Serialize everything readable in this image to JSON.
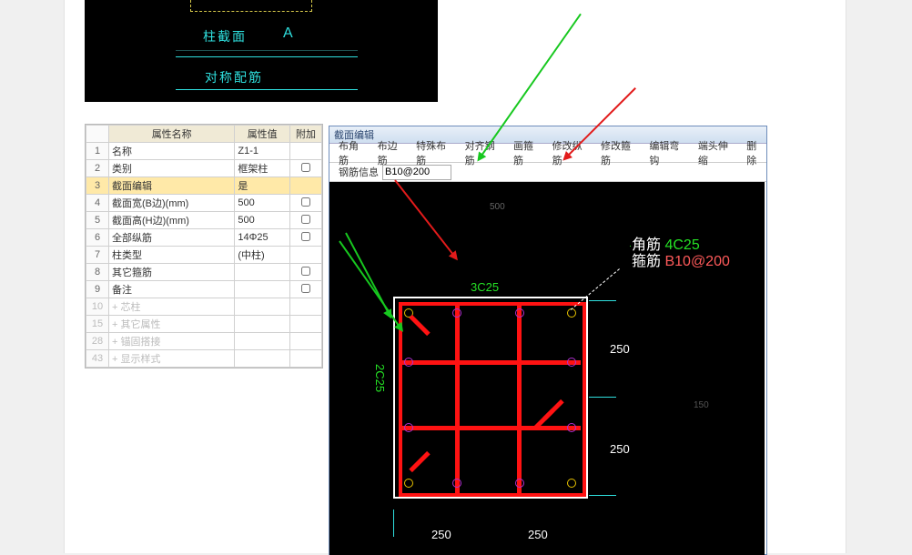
{
  "cad_top": {
    "section_label": "柱截面",
    "letter": "A",
    "sym_label": "对称配筋"
  },
  "prop": {
    "headers": [
      "属性名称",
      "属性值",
      "附加"
    ],
    "rows": [
      {
        "n": "1",
        "k": "名称",
        "v": "Z1-1"
      },
      {
        "n": "2",
        "k": "类别",
        "v": "框架柱"
      },
      {
        "n": "3",
        "k": "截面编辑",
        "v": "是"
      },
      {
        "n": "4",
        "k": "截面宽(B边)(mm)",
        "v": "500"
      },
      {
        "n": "5",
        "k": "截面高(H边)(mm)",
        "v": "500"
      },
      {
        "n": "6",
        "k": "全部纵筋",
        "v": "14Φ25"
      },
      {
        "n": "7",
        "k": "柱类型",
        "v": "(中柱)"
      },
      {
        "n": "8",
        "k": "其它箍筋",
        "v": ""
      },
      {
        "n": "9",
        "k": "备注",
        "v": ""
      },
      {
        "n": "10",
        "k": "+ 芯柱",
        "v": ""
      },
      {
        "n": "15",
        "k": "+ 其它属性",
        "v": ""
      },
      {
        "n": "28",
        "k": "+ 锚固搭接",
        "v": ""
      },
      {
        "n": "43",
        "k": "+ 显示样式",
        "v": ""
      }
    ]
  },
  "editor": {
    "title": "截面编辑",
    "toolbar": [
      "布角筋",
      "布边筋",
      "特殊布筋",
      "对齐钢筋",
      "画箍筋",
      "修改纵筋",
      "修改箍筋",
      "编辑弯钩",
      "端头伸缩",
      "删除"
    ],
    "info_label": "钢筋信息",
    "info_value": "B10@200",
    "dims": {
      "top500": "500",
      "r1": "250",
      "r2": "250",
      "b1": "250",
      "b2": "250",
      "left": "2C25",
      "top": "3C25",
      "side150": "150"
    },
    "notes": {
      "corner_label": "角筋",
      "corner_val": "4C25",
      "stirrup_label": "箍筋",
      "stirrup_val": "B10@200"
    }
  }
}
